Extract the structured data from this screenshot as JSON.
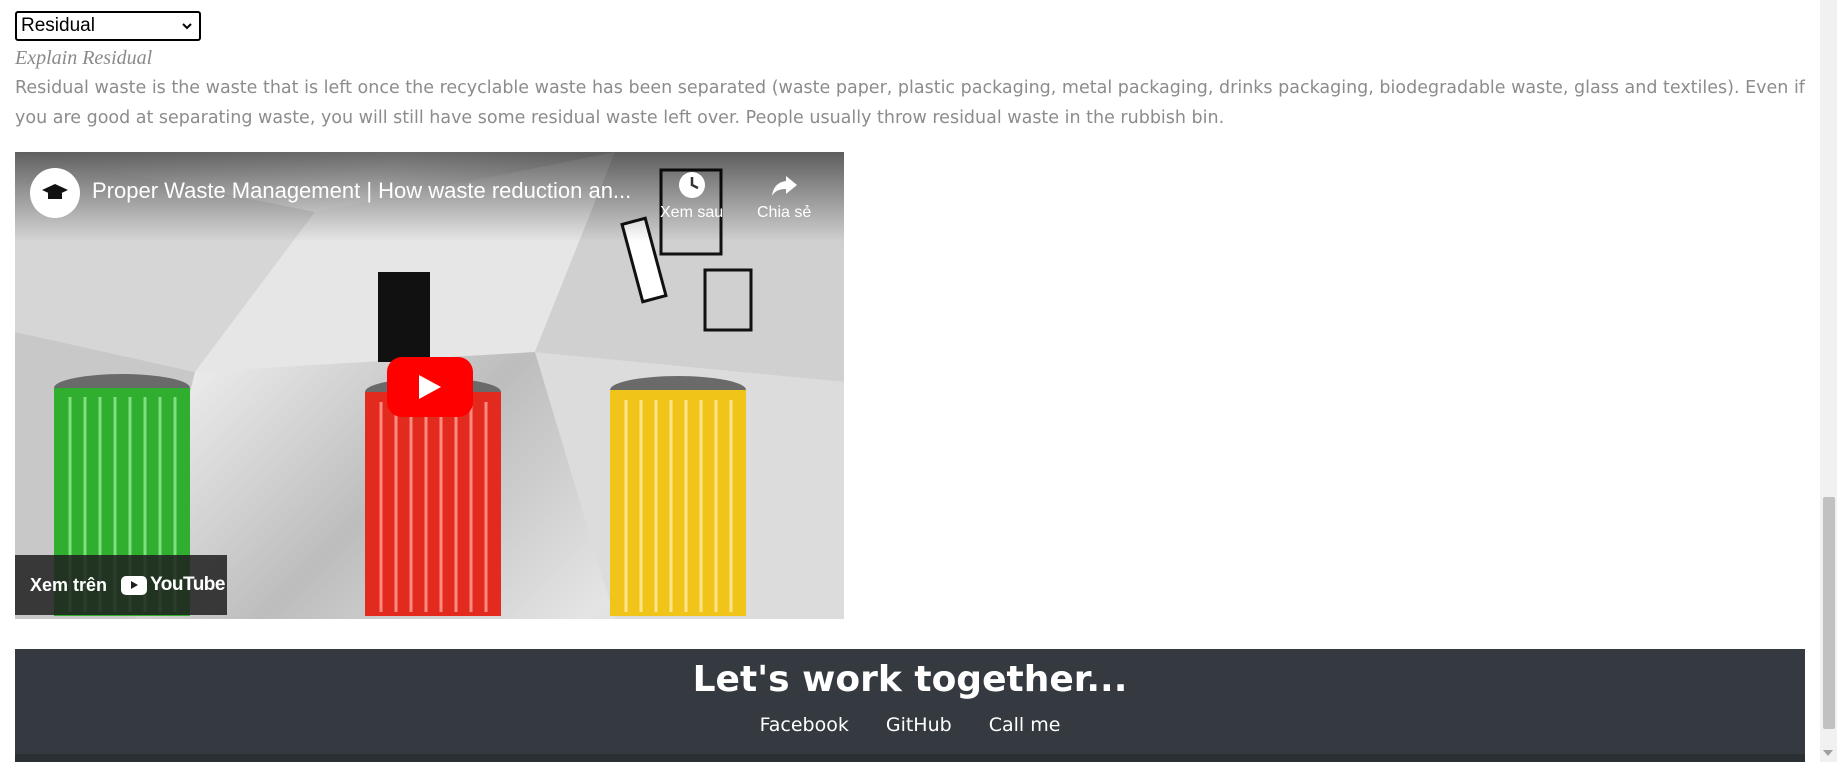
{
  "selector": {
    "selected": "Residual"
  },
  "explain": {
    "title": "Explain Residual",
    "text": "Residual waste is the waste that is left once the recyclable waste has been separated (waste paper, plastic packaging, metal packaging, drinks packaging, biodegradable waste, glass and textiles). Even if you are good at separating waste, you will still have some residual waste left over. People usually throw residual waste in the rubbish bin."
  },
  "video": {
    "title": "Proper Waste Management | How waste reduction an...",
    "watch_later_label": "Xem sau",
    "share_label": "Chia sẻ",
    "watch_on_label": "Xem trên",
    "youtube_label": "YouTube",
    "play_color": "#ff0000"
  },
  "footer": {
    "title": "Let's work together...",
    "links": [
      "Facebook",
      "GitHub",
      "Call me"
    ],
    "background": "#343a40"
  }
}
